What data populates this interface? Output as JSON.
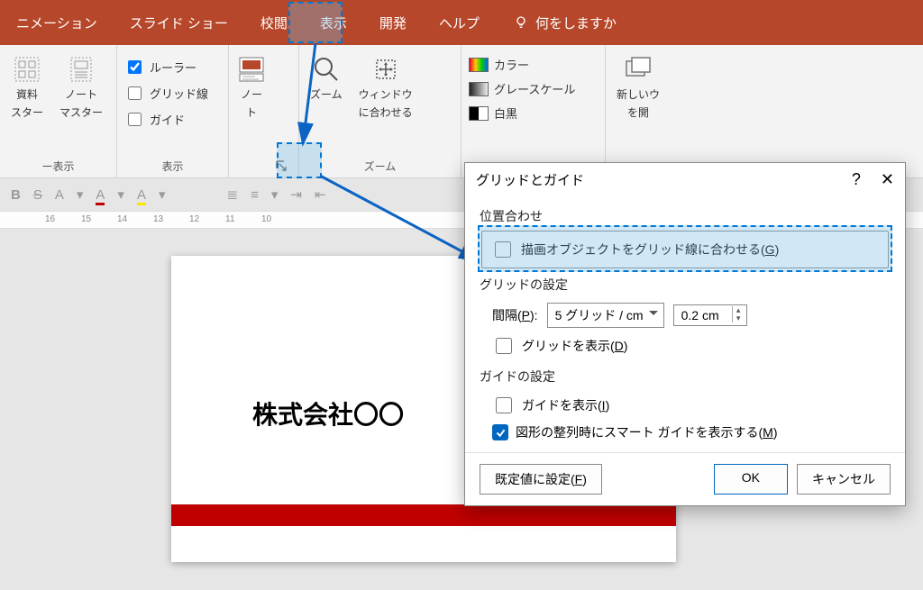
{
  "tabs": {
    "animations": "ニメーション",
    "slideshow": "スライド ショー",
    "review": "校閲",
    "view": "表示",
    "developer": "開発",
    "help": "ヘルプ",
    "tellme": "何をしますか"
  },
  "ribbon": {
    "masters": {
      "handout": "資料",
      "handout2": "スター",
      "notes": "ノート",
      "notes2": "マスター",
      "group": "ー表示"
    },
    "show": {
      "ruler": "ルーラー",
      "grid": "グリッド線",
      "guides": "ガイド",
      "group": "表示"
    },
    "notes_btn": {
      "l1": "ノー",
      "l2": "ト"
    },
    "zoom": {
      "zoom": "ズーム",
      "fit": "ウィンドウ",
      "fit2": "に合わせる",
      "group": "ズーム"
    },
    "color": {
      "color": "カラー",
      "gray": "グレースケール",
      "bw": "白黒"
    },
    "window": {
      "newwin1": "新しいウ",
      "newwin2": "を開"
    }
  },
  "fmt": {
    "b": "B",
    "s": "S",
    "a": "A"
  },
  "ruler_marks": [
    "16",
    "15",
    "14",
    "13",
    "12",
    "11",
    "10"
  ],
  "slide": {
    "title": "株式会社〇〇"
  },
  "dialog": {
    "title": "グリッドとガイド",
    "help": "?",
    "close": "✕",
    "sec_align": "位置合わせ",
    "snap": "描画オブジェクトをグリッド線に合わせる(",
    "snap_key": "G",
    "sec_grid": "グリッドの設定",
    "interval": "間隔(",
    "interval_key": "P",
    "interval_after": "):",
    "interval_val": "5 グリッド / cm",
    "spacing_val": "0.2 cm",
    "show_grid": "グリッドを表示(",
    "show_grid_key": "D",
    "sec_guide": "ガイドの設定",
    "show_guide": "ガイドを表示(",
    "show_guide_key": "I",
    "smart": "図形の整列時にスマート ガイドを表示する(",
    "smart_key": "M",
    "defaults": "既定値に設定(",
    "defaults_key": "F",
    "ok": "OK",
    "cancel": "キャンセル"
  }
}
